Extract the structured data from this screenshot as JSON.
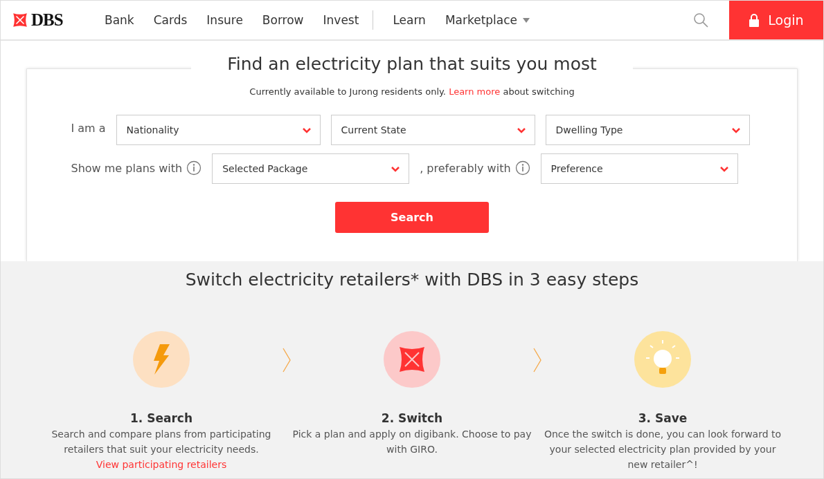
{
  "header": {
    "logo": "DBS",
    "nav": [
      {
        "label": "Bank",
        "kind": "link"
      },
      {
        "label": "Cards",
        "kind": "link"
      },
      {
        "label": "Insure",
        "kind": "link"
      },
      {
        "label": "Borrow",
        "kind": "link"
      },
      {
        "label": "Invest",
        "kind": "link"
      },
      {
        "label": "Learn",
        "kind": "divided"
      },
      {
        "label": "Marketplace",
        "kind": "dropdown"
      }
    ],
    "login": "Login"
  },
  "finder": {
    "title": "Find an electricity plan that suits you most",
    "note": "Currently available to Jurong residents only.",
    "note_link": "Learn more",
    "note_end": "about switching",
    "row1_label": "I am a",
    "row1_selects": [
      "Nationality",
      "Current State",
      "Dwelling Type"
    ],
    "row2_label": "Show me plans with",
    "row2_select": "Selected Package",
    "row2_mid": ", preferably with",
    "row2_select2": "Preference",
    "search": "Search"
  },
  "steps": {
    "title": "Switch electricity retailers* with DBS in 3 easy steps",
    "items": [
      {
        "kind": "bolt",
        "title": "1. Search",
        "text": "Search and compare plans from participating retailers that suit your electricity needs.",
        "link": "View participating retailers"
      },
      {
        "kind": "switch",
        "title": "2. Switch",
        "text": "Pick a plan and apply on digibank. Choose to pay with GIRO."
      },
      {
        "kind": "bulb",
        "title": "3. Save",
        "text": "Once the switch is done, you can look forward to your selected electricity plan provided by your new retailer^!"
      }
    ]
  }
}
